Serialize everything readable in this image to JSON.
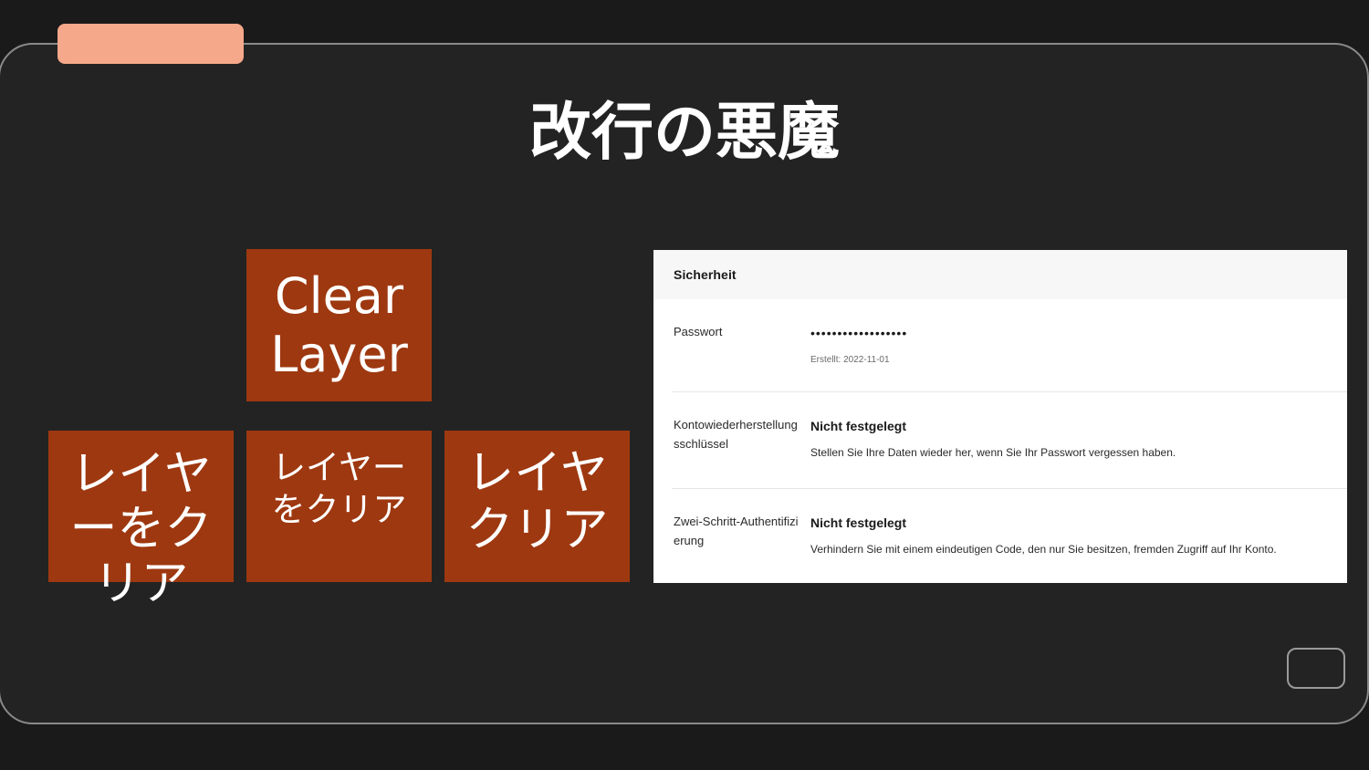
{
  "slide": {
    "title": "改行の悪魔"
  },
  "tiles": {
    "english": "Clear Layer",
    "japanese_1": "レイヤーをクリア",
    "japanese_2": "レイヤーをクリア",
    "japanese_3": "レイヤクリア"
  },
  "settings": {
    "header": "Sicherheit",
    "rows": [
      {
        "label": "Passwort",
        "value": "••••••••••••••••••",
        "meta": "Erstellt: 2022-11-01"
      },
      {
        "label": "Kontowiederherstellungsschlüssel",
        "value": "Nicht festgelegt",
        "description": "Stellen Sie Ihre Daten wieder her, wenn Sie Ihr Passwort vergessen haben."
      },
      {
        "label": "Zwei-Schritt-Authentifizierung",
        "value": "Nicht festgelegt",
        "description": "Verhindern Sie mit einem eindeutigen Code, den nur Sie besitzen, fremden Zugriff auf Ihr Konto."
      }
    ]
  },
  "colors": {
    "background": "#1a1a1a",
    "slide": "#232323",
    "accent_pill": "#f6a88a",
    "tile": "#9e3810"
  }
}
